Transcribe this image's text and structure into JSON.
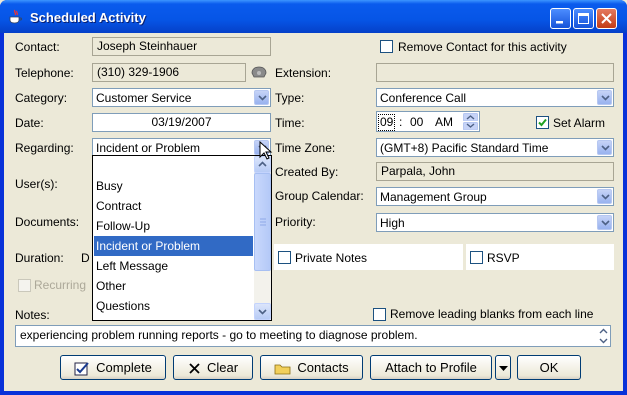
{
  "window": {
    "title": "Scheduled Activity"
  },
  "fields": {
    "contact": {
      "label": "Contact:",
      "value": "Joseph Steinhauer"
    },
    "remove_contact": {
      "label": "Remove Contact for this activity",
      "checked": false
    },
    "telephone": {
      "label": "Telephone:",
      "value": "(310) 329-1906"
    },
    "extension": {
      "label": "Extension:",
      "value": ""
    },
    "category": {
      "label": "Category:",
      "value": "Customer Service"
    },
    "type": {
      "label": "Type:",
      "value": "Conference Call"
    },
    "date": {
      "label": "Date:",
      "value": "03/19/2007"
    },
    "time": {
      "label": "Time:",
      "hour": "09",
      "sep": ":",
      "minute": "00",
      "ampm": "AM"
    },
    "set_alarm": {
      "label": "Set Alarm",
      "checked": true
    },
    "regarding": {
      "label": "Regarding:",
      "value": "Incident or Problem"
    },
    "time_zone": {
      "label": "Time Zone:",
      "value": "(GMT+8) Pacific Standard Time"
    },
    "users": {
      "label": "User(s):"
    },
    "created_by": {
      "label": "Created By:",
      "value": "Parpala, John"
    },
    "group_calendar": {
      "label": "Group Calendar:",
      "value": "Management Group"
    },
    "documents": {
      "label": "Documents:"
    },
    "priority": {
      "label": "Priority:",
      "value": "High"
    },
    "duration": {
      "label": "Duration:",
      "value_partial": "D"
    },
    "private_notes": {
      "label": "Private Notes",
      "checked": false
    },
    "rsvp": {
      "label": "RSVP",
      "checked": false
    },
    "recurring": {
      "label": "Recurring",
      "checked": false
    },
    "notes": {
      "label": "Notes:",
      "value": "experiencing problem running reports - go to meeting to diagnose problem."
    },
    "remove_blanks": {
      "label": "Remove leading blanks from each line",
      "checked": false
    }
  },
  "regarding_dropdown": {
    "items": [
      "",
      "Busy",
      "Contract",
      "Follow-Up",
      "Incident or Problem",
      "Left Message",
      "Other",
      "Questions"
    ],
    "selected_index": 4
  },
  "buttons": {
    "complete": "Complete",
    "clear": "Clear",
    "contacts": "Contacts",
    "attach": "Attach to Profile",
    "ok": "OK"
  },
  "colors": {
    "titlebar": "#0a5bed",
    "selection": "#316ac5",
    "face": "#ece9d8"
  }
}
